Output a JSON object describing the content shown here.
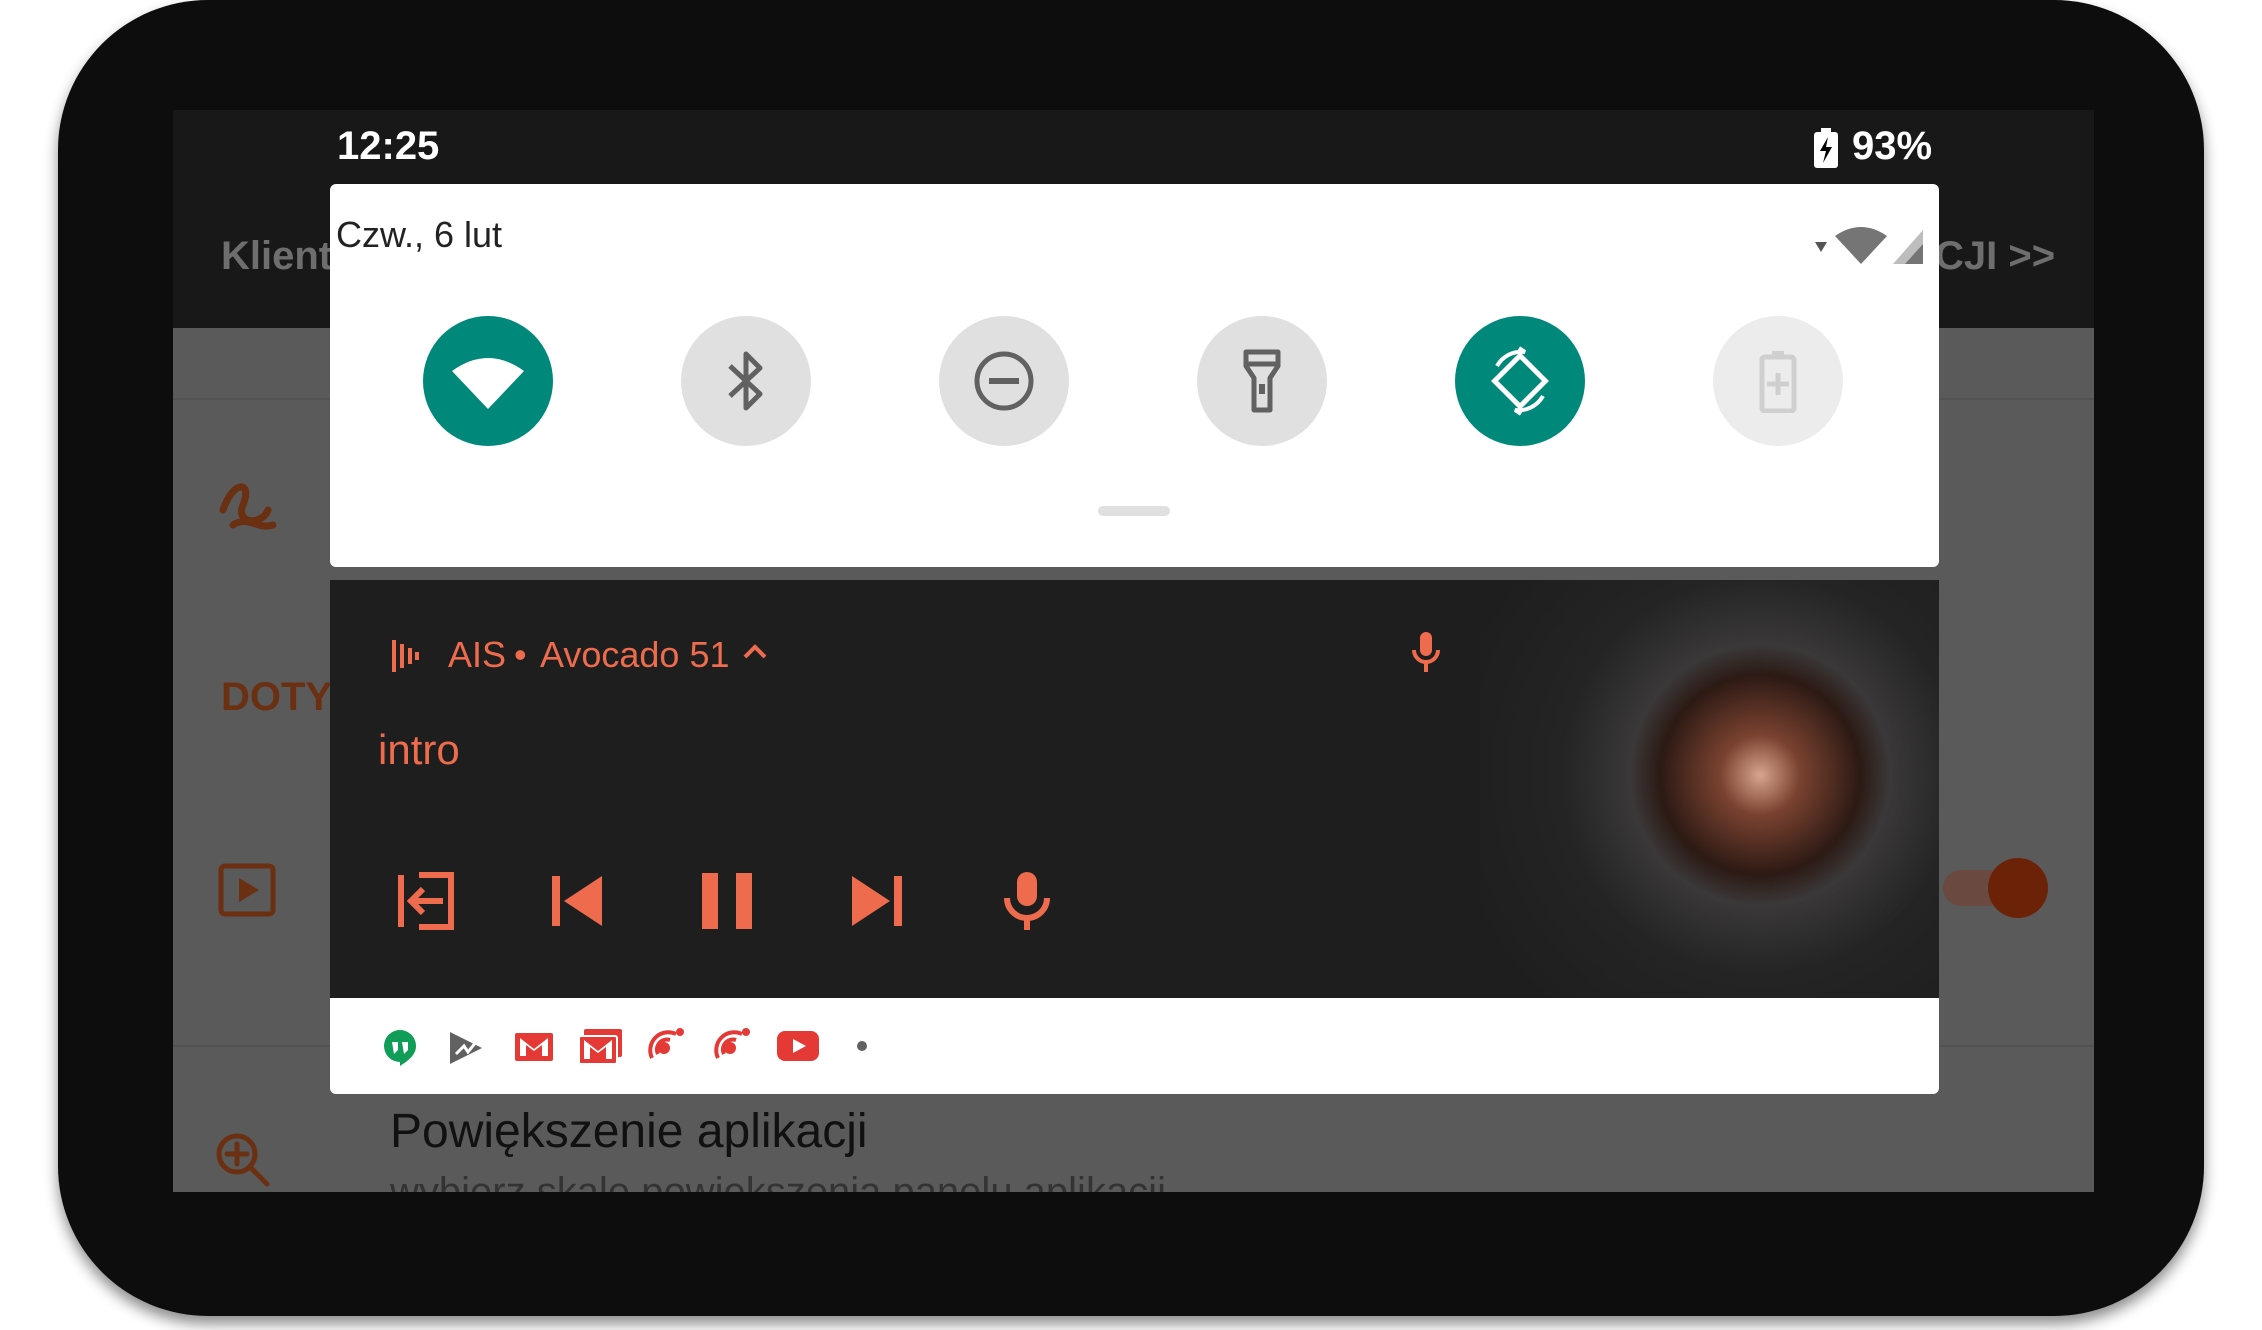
{
  "status_bar": {
    "time": "12:25",
    "battery": "93%"
  },
  "background_app": {
    "header_left": "Klient",
    "header_right": "CJI >>",
    "section_label": "DOTY",
    "setting_title": "Powiększenie aplikacji",
    "setting_subtitle": "wybierz skalę powiększenia panelu aplikacji"
  },
  "quick_settings": {
    "date": "Czw., 6 lut",
    "tiles": [
      {
        "icon": "wifi-icon",
        "state": "on"
      },
      {
        "icon": "bluetooth-icon",
        "state": "off"
      },
      {
        "icon": "do-not-disturb-icon",
        "state": "off"
      },
      {
        "icon": "flashlight-icon",
        "state": "off"
      },
      {
        "icon": "auto-rotate-icon",
        "state": "on"
      },
      {
        "icon": "battery-saver-icon",
        "state": "disabled"
      }
    ]
  },
  "media_notification": {
    "app_name": "AIS",
    "separator": "•",
    "device": "Avocado 51",
    "track_title": "intro",
    "controls": [
      "exit-icon",
      "previous-icon",
      "pause-icon",
      "next-icon",
      "microphone-icon"
    ]
  },
  "notification_icons": [
    "hangouts-icon",
    "play-store-icon",
    "gmail-icon",
    "gmail-icon",
    "radio-icon",
    "radio-icon",
    "youtube-icon",
    "more-dot-icon"
  ],
  "colors": {
    "accent_teal": "#00897b",
    "media_orange": "#ee6c4d",
    "media_bg": "#1e1e1e"
  }
}
